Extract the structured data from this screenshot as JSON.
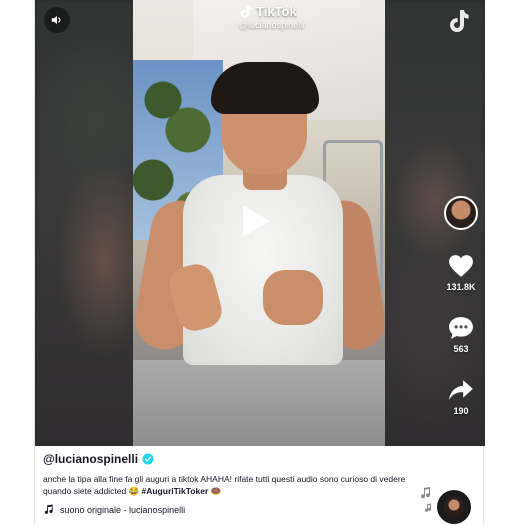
{
  "brand": {
    "name": "TikTok",
    "handle": "@lucianospinelli"
  },
  "stats": {
    "likes": "131.8K",
    "comments": "563",
    "shares": "190"
  },
  "caption": {
    "username": "@lucianospinelli",
    "text": "anche la tipa alla fine fa gli auguri a tiktok AHAHA! rifate tutti questi audio sono curioso di vedere quando siete addicted 😂",
    "hashtag": "#AuguriTikToker",
    "emoji_end": "🍩",
    "sound": "suono originale - lucianospinelli"
  },
  "colors": {
    "text": "#161823",
    "verified": "#20d5ec",
    "overlay": "#ffffff"
  },
  "icons": [
    "volume-icon",
    "tiktok-logo-icon",
    "play-icon",
    "heart-icon",
    "comment-icon",
    "share-icon",
    "verified-icon",
    "music-note-icon"
  ]
}
